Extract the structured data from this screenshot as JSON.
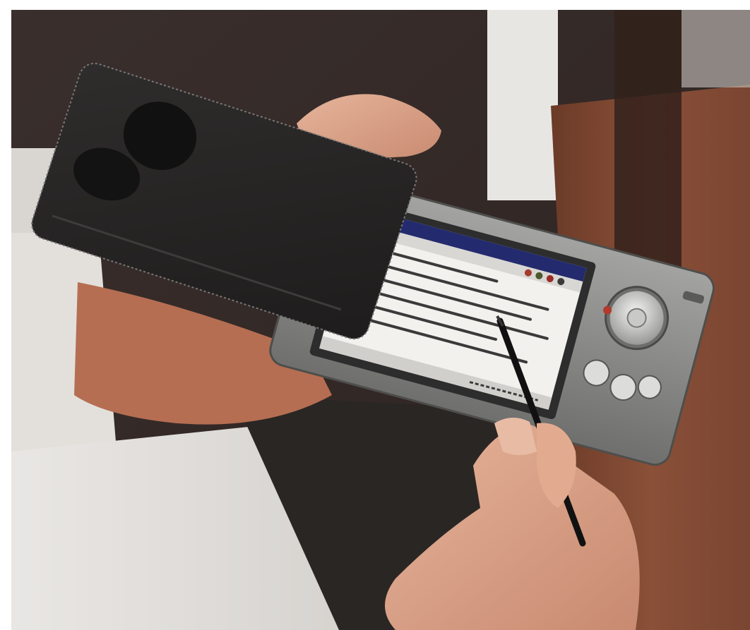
{
  "image": {
    "kind": "photograph",
    "subject": "handheld-pda-with-stylus",
    "colors": {
      "wall": "#3a2f2d",
      "wood": "#7a4531",
      "sleeve": "#292727",
      "device_body": "#8a8a88",
      "screen_bg": "#f2f1ee",
      "screen_titlebar": "#232b6e",
      "skin": "#d9a187"
    },
    "icons": [
      "dpad-icon",
      "left-button-icon",
      "right-button-icon",
      "stylus-icon"
    ]
  }
}
